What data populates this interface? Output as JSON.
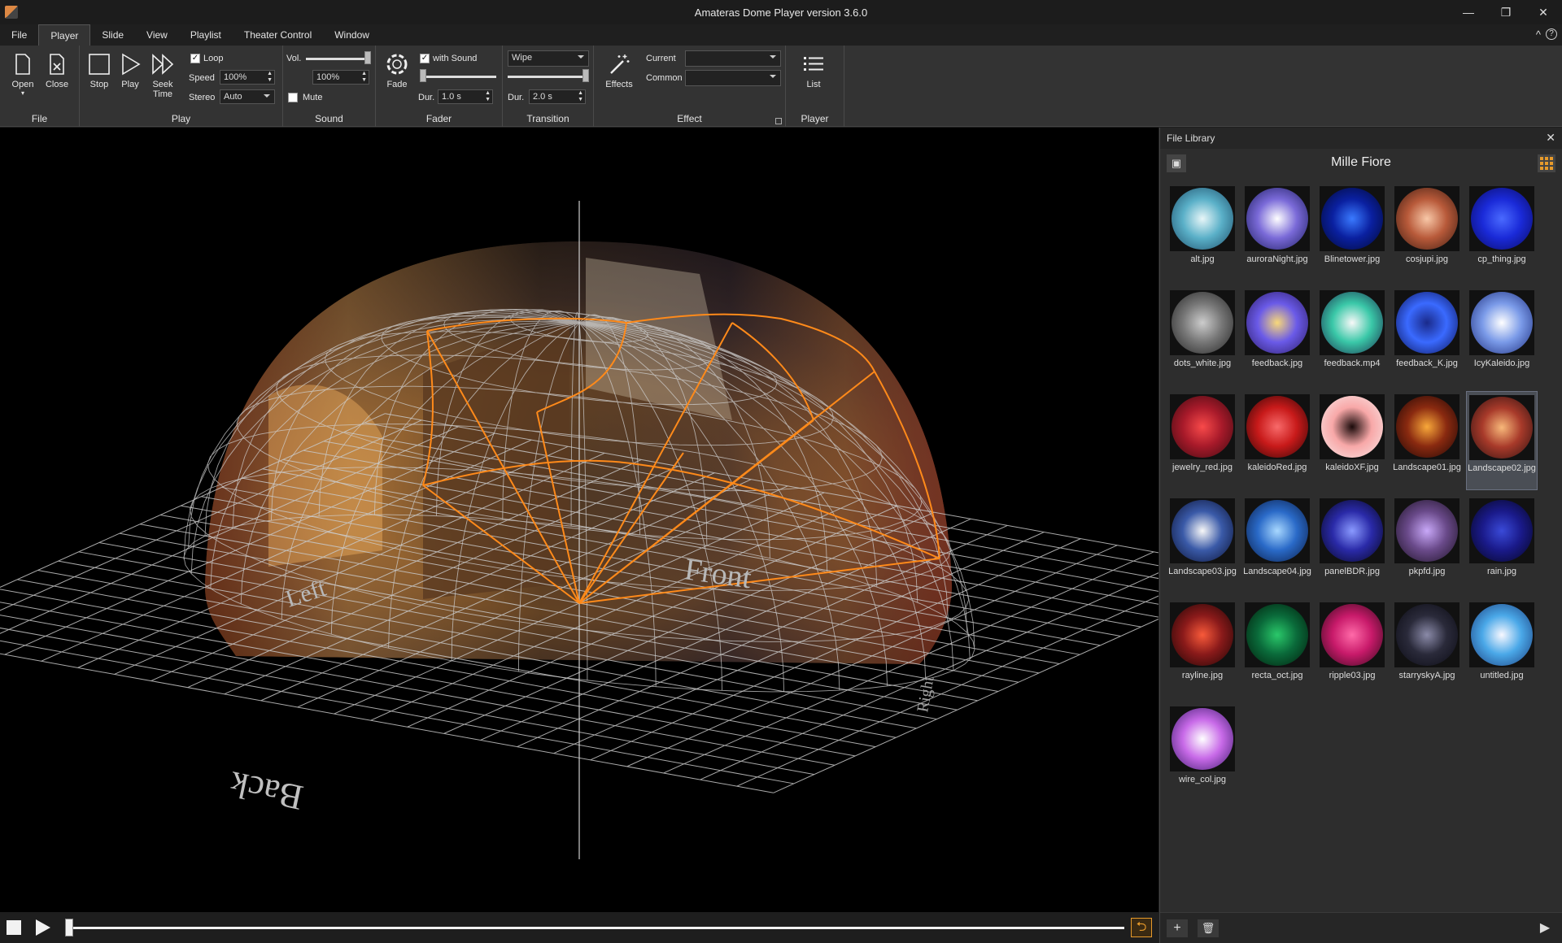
{
  "window": {
    "title": "Amateras Dome Player version 3.6.0",
    "minimize": "—",
    "maximize": "❐",
    "close": "✕"
  },
  "menu": {
    "items": [
      {
        "label": "File",
        "active": false
      },
      {
        "label": "Player",
        "active": true
      },
      {
        "label": "Slide",
        "active": false
      },
      {
        "label": "View",
        "active": false
      },
      {
        "label": "Playlist",
        "active": false
      },
      {
        "label": "Theater Control",
        "active": false
      },
      {
        "label": "Window",
        "active": false
      }
    ],
    "collapse_icon": "^",
    "help_icon": "?"
  },
  "ribbon": {
    "file": {
      "group": "File",
      "open": "Open",
      "close": "Close"
    },
    "play": {
      "group": "Play",
      "stop": "Stop",
      "play": "Play",
      "seek_line1": "Seek",
      "seek_line2": "Time",
      "loop_label": "Loop",
      "loop_checked": true,
      "speed_label": "Speed",
      "speed_value": "100%",
      "stereo_label": "Stereo",
      "stereo_value": "Auto"
    },
    "sound": {
      "group": "Sound",
      "vol_label": "Vol.",
      "vol_value": "100%",
      "mute_label": "Mute",
      "mute_checked": false
    },
    "fader": {
      "group": "Fader",
      "fade": "Fade",
      "with_sound_label": "with Sound",
      "with_sound_checked": true,
      "dur_label": "Dur.",
      "dur_value": "1.0 s"
    },
    "transition": {
      "group": "Transition",
      "type": "Wipe",
      "dur_label": "Dur.",
      "dur_value": "2.0 s"
    },
    "effect": {
      "group": "Effect",
      "effects": "Effects",
      "current_label": "Current",
      "current_value": "",
      "common_label": "Common",
      "common_value": ""
    },
    "player": {
      "group": "Player",
      "list": "List"
    }
  },
  "viewport": {
    "labels": {
      "front": "Front",
      "left": "Left",
      "back": "Back",
      "right": "Right"
    }
  },
  "library": {
    "header": "File Library",
    "close": "✕",
    "title": "Mille Fiore",
    "files": [
      {
        "name": "alt.jpg",
        "colors": [
          "#e8f6f8",
          "#5ab0c8",
          "#1c4a66"
        ]
      },
      {
        "name": "auroraNight.jpg",
        "colors": [
          "#ffffff",
          "#7a6ad8",
          "#1a1a5a"
        ]
      },
      {
        "name": "Blinetower.jpg",
        "colors": [
          "#3a7aff",
          "#0a20a0",
          "#020830"
        ]
      },
      {
        "name": "cosjupi.jpg",
        "colors": [
          "#f8c8a8",
          "#b85a3a",
          "#3a1a10"
        ]
      },
      {
        "name": "cp_thing.jpg",
        "colors": [
          "#4a6aff",
          "#1a2ad8",
          "#0a0a60"
        ]
      },
      {
        "name": "dots_white.jpg",
        "colors": [
          "#cccccc",
          "#777777",
          "#222222"
        ]
      },
      {
        "name": "feedback.jpg",
        "colors": [
          "#f8d878",
          "#6a5ae8",
          "#2a1a60"
        ]
      },
      {
        "name": "feedback.mp4",
        "colors": [
          "#f8f8f8",
          "#3ac8a8",
          "#1a2a4a"
        ]
      },
      {
        "name": "feedback_K.jpg",
        "colors": [
          "#1a2a8a",
          "#3a6aff",
          "#0a1050"
        ]
      },
      {
        "name": "IcyKaleido.jpg",
        "colors": [
          "#ffffff",
          "#7a9ae8",
          "#1a2a7a"
        ]
      },
      {
        "name": "jewelry_red.jpg",
        "colors": [
          "#f84a4a",
          "#a81a2a",
          "#3a0a10"
        ]
      },
      {
        "name": "kaleidoRed.jpg",
        "colors": [
          "#f86a6a",
          "#c81a1a",
          "#2a0505"
        ]
      },
      {
        "name": "kaleidoXF.jpg",
        "colors": [
          "#1a0a0a",
          "#f8a8a8",
          "#f8e8e8"
        ]
      },
      {
        "name": "Landscape01.jpg",
        "colors": [
          "#f8a83a",
          "#8a2a10",
          "#1a0505"
        ]
      },
      {
        "name": "Landscape02.jpg",
        "colors": [
          "#f8b87a",
          "#a83a2a",
          "#2a1010"
        ]
      },
      {
        "name": "Landscape03.jpg",
        "colors": [
          "#f8f8f8",
          "#3a5aa8",
          "#0a1030"
        ]
      },
      {
        "name": "Landscape04.jpg",
        "colors": [
          "#a8d8ff",
          "#2a6ac8",
          "#0a1a40"
        ]
      },
      {
        "name": "panelBDR.jpg",
        "colors": [
          "#8a9aff",
          "#2a2aa8",
          "#05051a"
        ]
      },
      {
        "name": "pkpfd.jpg",
        "colors": [
          "#c8a8f8",
          "#6a4a8a",
          "#1a1020"
        ]
      },
      {
        "name": "rain.jpg",
        "colors": [
          "#3a4ad8",
          "#1a1a8a",
          "#05051a"
        ]
      },
      {
        "name": "rayline.jpg",
        "colors": [
          "#f85a3a",
          "#8a1a1a",
          "#1a0505"
        ]
      },
      {
        "name": "recta_oct.jpg",
        "colors": [
          "#2ac86a",
          "#0a6a3a",
          "#021a0a"
        ]
      },
      {
        "name": "ripple03.jpg",
        "colors": [
          "#ff6aa8",
          "#c81a6a",
          "#300a1a"
        ]
      },
      {
        "name": "starryskyA.jpg",
        "colors": [
          "#8a8aa8",
          "#2a2a3a",
          "#0a0a12"
        ]
      },
      {
        "name": "untitled.jpg",
        "colors": [
          "#f8f8ff",
          "#4aa8e8",
          "#1a3a7a"
        ]
      },
      {
        "name": "wire_col.jpg",
        "colors": [
          "#ffffff",
          "#c86ae8",
          "#3a1a6a"
        ]
      }
    ],
    "selected": "Landscape02.jpg",
    "add": "+",
    "delete": "🗑",
    "play": "▶"
  },
  "colors": {
    "accent": "#e79a2a",
    "frustum": "#ff8a1a",
    "grid": "#c8c8c8"
  }
}
